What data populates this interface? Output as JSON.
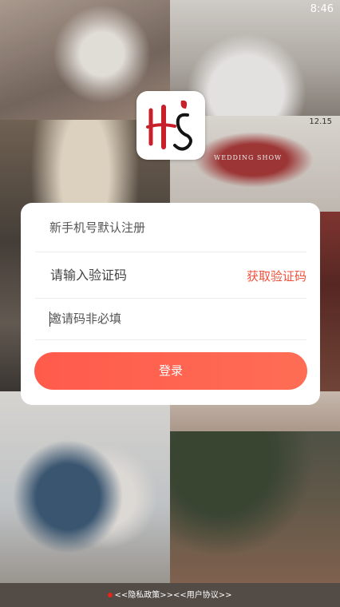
{
  "status_bar": {
    "time": "8:46"
  },
  "background": {
    "sign_text": "WEDDING SHOW",
    "sign_date": "12.15"
  },
  "login": {
    "phone_placeholder": "新手机号默认注册",
    "code_placeholder": "请输入验证码",
    "get_code_label": "获取验证码",
    "invite_placeholder": "邀请码非必填",
    "submit_label": "登录"
  },
  "footer": {
    "privacy_link": "<<隐私政策>>",
    "agreement_link": "<<用户协议>>"
  },
  "colors": {
    "accent": "#f0503b",
    "brand_red": "#c8202a"
  }
}
